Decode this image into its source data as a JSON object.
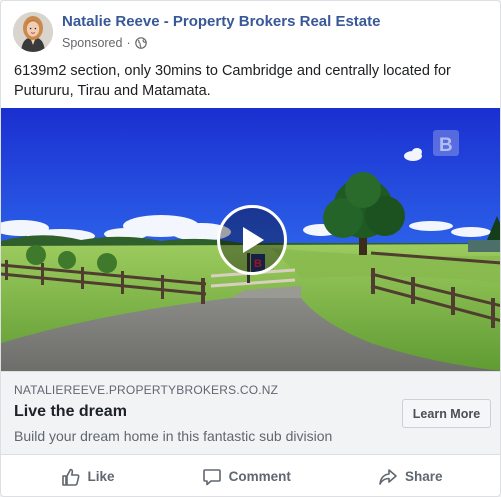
{
  "post": {
    "author": "Natalie Reeve - Property Brokers Real Estate",
    "sponsored_label": "Sponsored",
    "meta_separator": "·",
    "audience_icon": "globe-icon",
    "text": "6139m2 section, only 30mins to Cambridge and centrally located for Putururu, Tirau and Matamata."
  },
  "media": {
    "type": "video",
    "play_icon": "play-icon",
    "sign_letter": "B"
  },
  "link": {
    "domain": "NATALIEREEVE.PROPERTYBROKERS.CO.NZ",
    "title": "Live the dream",
    "description": "Build your dream home in this fantastic sub division",
    "cta_label": "Learn More"
  },
  "actions": [
    {
      "label": "Like",
      "icon": "thumbs-up-icon"
    },
    {
      "label": "Comment",
      "icon": "comment-icon"
    },
    {
      "label": "Share",
      "icon": "share-icon"
    }
  ],
  "colors": {
    "author_link": "#385898",
    "secondary_text": "#606770",
    "sky_top": "#1a2fd0",
    "grass": "#7fb84a"
  }
}
